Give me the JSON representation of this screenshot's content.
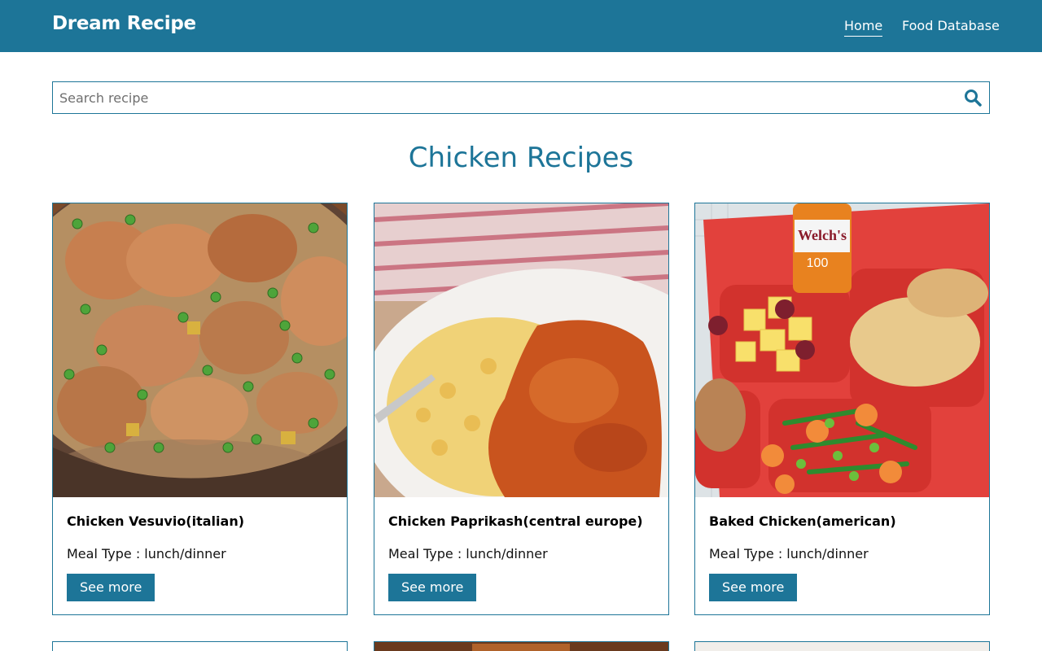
{
  "app": {
    "brand": "Dream Recipe"
  },
  "nav": {
    "items": [
      {
        "label": "Home",
        "active": true
      },
      {
        "label": "Food Database",
        "active": false
      }
    ]
  },
  "search": {
    "placeholder": "Search recipe",
    "value": ""
  },
  "section": {
    "title": "Chicken Recipes"
  },
  "recipes": [
    {
      "title": "Chicken Vesuvio(italian)",
      "meal": "Meal Type : lunch/dinner",
      "button": "See more"
    },
    {
      "title": "Chicken Paprikash(central europe)",
      "meal": "Meal Type : lunch/dinner",
      "button": "See more"
    },
    {
      "title": "Baked Chicken(american)",
      "meal": "Meal Type : lunch/dinner",
      "button": "See more"
    }
  ],
  "images": [
    {
      "text": "Welch's"
    },
    {
      "text": "100"
    }
  ],
  "colors": {
    "primary": "#1d7598",
    "background": "#ffffff"
  }
}
